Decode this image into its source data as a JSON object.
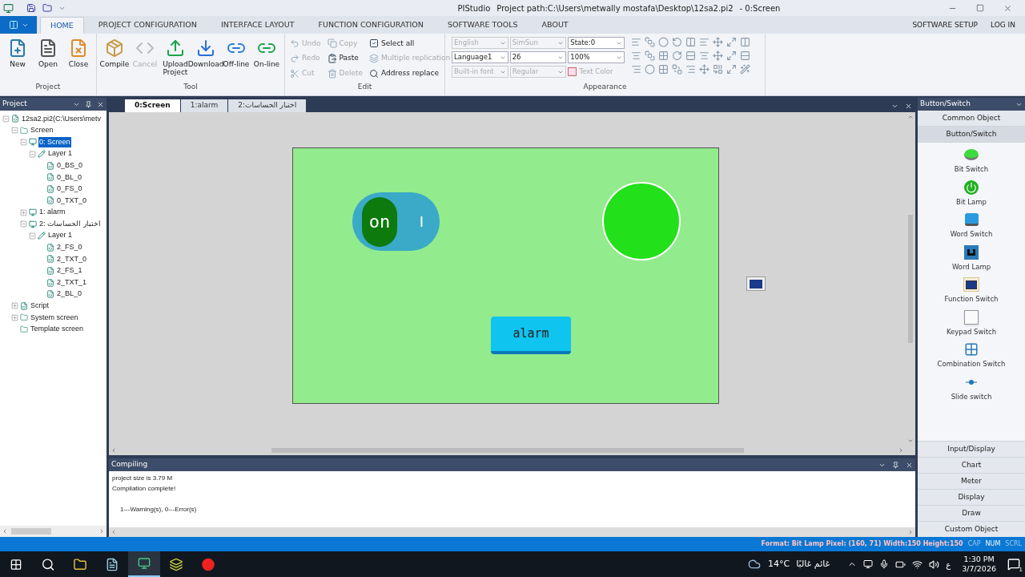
{
  "window": {
    "app": "PIStudio",
    "path": "Project path:C:\\Users\\metwally mostafa\\Desktop\\12sa2.pi2",
    "screen": "- 0:Screen"
  },
  "ribbon_tabs": [
    {
      "label": "HOME",
      "selected": true
    },
    {
      "label": "PROJECT CONFIGURATION",
      "selected": false
    },
    {
      "label": "INTERFACE LAYOUT",
      "selected": false
    },
    {
      "label": "FUNCTION CONFIGURATION",
      "selected": false
    },
    {
      "label": "SOFTWARE TOOLS",
      "selected": false
    },
    {
      "label": "ABOUT",
      "selected": false
    }
  ],
  "ribbon_links": [
    "SOFTWARE SETUP",
    "LOG IN"
  ],
  "project_group": {
    "label": "Project",
    "buttons": [
      {
        "label": "New",
        "disabled": false
      },
      {
        "label": "Open",
        "disabled": false
      },
      {
        "label": "Close",
        "disabled": false
      }
    ]
  },
  "tool_group": {
    "label": "Tool",
    "buttons": [
      {
        "label": "Compile",
        "disabled": false
      },
      {
        "label": "Cancel",
        "disabled": true
      },
      {
        "label": "Upload Project",
        "disabled": false
      },
      {
        "label": "Download",
        "disabled": false
      },
      {
        "label": "Off-line",
        "disabled": false
      },
      {
        "label": "On-line",
        "disabled": false
      }
    ]
  },
  "edit_group": {
    "label": "Edit",
    "items": [
      {
        "label": "Undo",
        "disabled": true
      },
      {
        "label": "Redo",
        "disabled": true
      },
      {
        "label": "Cut",
        "disabled": true
      },
      {
        "label": "Copy",
        "disabled": true
      },
      {
        "label": "Paste",
        "disabled": false
      },
      {
        "label": "Delete",
        "disabled": true
      },
      {
        "label": "Select all",
        "disabled": false
      },
      {
        "label": "Multiple replication",
        "disabled": true
      },
      {
        "label": "Address replace",
        "disabled": false
      }
    ]
  },
  "appearance_group": {
    "label": "Appearance",
    "dropdowns": [
      {
        "value": "English",
        "disabled": true
      },
      {
        "value": "SimSun",
        "disabled": true
      },
      {
        "value": "State:0",
        "disabled": false
      },
      {
        "value": "Language1",
        "disabled": false
      },
      {
        "value": "26",
        "disabled": false
      },
      {
        "value": "100%",
        "disabled": false
      },
      {
        "value": "Built-in font",
        "disabled": true
      },
      {
        "value": "Regular",
        "disabled": true
      }
    ],
    "text_color": {
      "label": "Text Color",
      "disabled": true
    }
  },
  "project_panel": {
    "title": "Project",
    "tree": [
      {
        "label": "12sa2.pi2(C:\\Users\\metv",
        "kind": "project",
        "expanded": true,
        "selected": false,
        "children": [
          {
            "label": "Screen",
            "kind": "folder",
            "expanded": true,
            "selected": false,
            "children": [
              {
                "label": "0: Screen",
                "kind": "screen",
                "expanded": true,
                "selected": true,
                "children": [
                  {
                    "label": "Layer 1",
                    "kind": "layer",
                    "expanded": true,
                    "selected": false,
                    "children": [
                      {
                        "label": "0_BS_0",
                        "kind": "object",
                        "selected": false
                      },
                      {
                        "label": "0_BL_0",
                        "kind": "object",
                        "selected": false
                      },
                      {
                        "label": "0_FS_0",
                        "kind": "object",
                        "selected": false
                      },
                      {
                        "label": "0_TXT_0",
                        "kind": "object",
                        "selected": false
                      }
                    ]
                  }
                ]
              },
              {
                "label": "1: alarm",
                "kind": "screen",
                "expanded": false,
                "selected": false
              },
              {
                "label": "اختبار الحساسات :2",
                "kind": "screen",
                "expanded": true,
                "selected": false,
                "children": [
                  {
                    "label": "Layer 1",
                    "kind": "layer",
                    "expanded": true,
                    "selected": false,
                    "children": [
                      {
                        "label": "2_FS_0",
                        "kind": "object",
                        "selected": false
                      },
                      {
                        "label": "2_TXT_0",
                        "kind": "object",
                        "selected": false
                      },
                      {
                        "label": "2_FS_1",
                        "kind": "object",
                        "selected": false
                      },
                      {
                        "label": "2_TXT_1",
                        "kind": "object",
                        "selected": false
                      },
                      {
                        "label": "2_BL_0",
                        "kind": "object",
                        "selected": false
                      }
                    ]
                  }
                ]
              }
            ]
          },
          {
            "label": "Script",
            "kind": "script",
            "expanded": false,
            "selected": false
          },
          {
            "label": "System screen",
            "kind": "folder",
            "expanded": false,
            "selected": false
          },
          {
            "label": "Template screen",
            "kind": "folder",
            "selected": false
          }
        ]
      }
    ]
  },
  "editor_tabs": [
    {
      "label": "0:Screen",
      "selected": true
    },
    {
      "label": "1:alarm",
      "selected": false
    },
    {
      "label": "اختبار الحساسات:2",
      "selected": false
    }
  ],
  "canvas": {
    "toggle": {
      "label": "on",
      "mark": "I",
      "on": true
    },
    "lamp": {
      "on": true
    },
    "button": {
      "label": "alarm"
    }
  },
  "compile_panel": {
    "title": "Compiling",
    "lines": [
      "project size is 3.79 M",
      "Compilation complete!",
      "1---Warning(s), 0---Error(s)"
    ]
  },
  "toolbox": {
    "title": "Button/Switch",
    "sections": [
      {
        "label": "Common Object",
        "selected": false
      },
      {
        "label": "Button/Switch",
        "selected": true
      }
    ],
    "tools": [
      "Bit Switch",
      "Bit Lamp",
      "Word Switch",
      "Word Lamp",
      "Function Switch",
      "Keypad Switch",
      "Combination Switch",
      "Slide switch"
    ],
    "categories": [
      "Input/Display",
      "Chart",
      "Meter",
      "Display",
      "Draw",
      "Custom Object"
    ]
  },
  "status_bar": {
    "info": "Format: Bit Lamp Pixel: (160, 71) Width:150 Height:150",
    "indicators": [
      {
        "label": "CAP",
        "on": false
      },
      {
        "label": "NUM",
        "on": true
      },
      {
        "label": "SCRL",
        "on": false
      }
    ]
  },
  "taskbar": {
    "temperature": "14°C",
    "weather": "غائم غالبًا",
    "language": "ع",
    "time": "1:30 PM",
    "date": "3/7/2026",
    "notifications": "1"
  }
}
